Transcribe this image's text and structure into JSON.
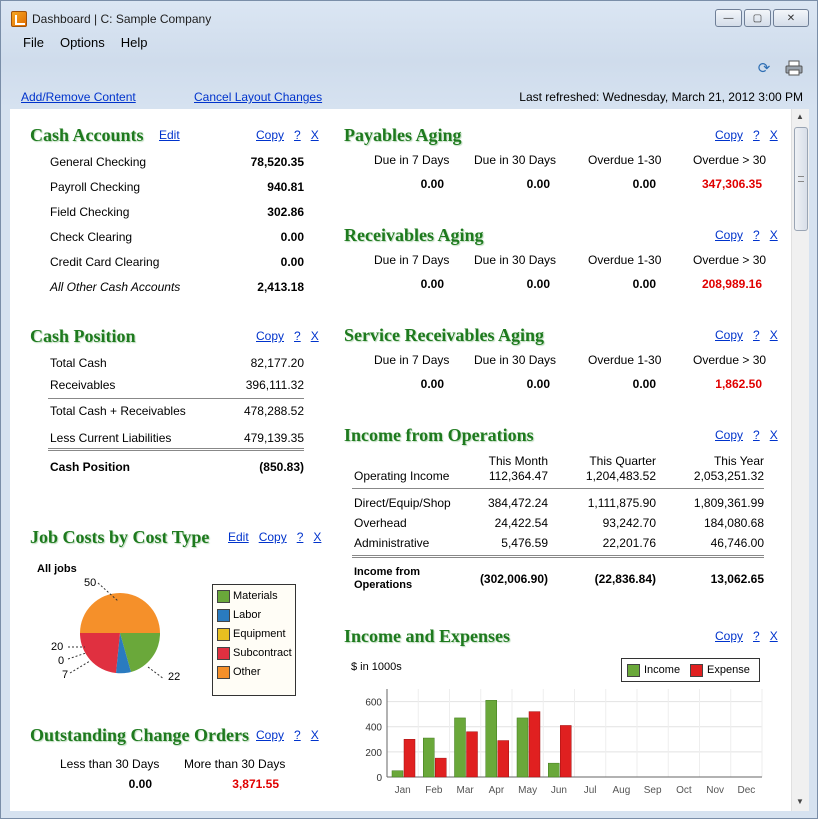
{
  "window": {
    "title": "Dashboard  |  C: Sample Company",
    "min": "—",
    "max": "▢",
    "close": "✕"
  },
  "menu": {
    "file": "File",
    "options": "Options",
    "help": "Help"
  },
  "toolbar": {
    "add_remove": "Add/Remove Content",
    "cancel_layout": "Cancel Layout Changes",
    "last_refreshed": "Last refreshed:  Wednesday, March 21, 2012  3:00 PM"
  },
  "common": {
    "edit": "Edit",
    "copy": "Copy",
    "help": "?",
    "close": "X"
  },
  "cash_accounts": {
    "title": "Cash Accounts",
    "rows": [
      {
        "label": "General Checking",
        "value": "78,520.35"
      },
      {
        "label": "Payroll Checking",
        "value": "940.81"
      },
      {
        "label": "Field Checking",
        "value": "302.86"
      },
      {
        "label": "Check Clearing",
        "value": "0.00"
      },
      {
        "label": "Credit Card Clearing",
        "value": "0.00"
      },
      {
        "label": "All Other Cash Accounts",
        "value": "2,413.18"
      }
    ]
  },
  "cash_position": {
    "title": "Cash Position",
    "rows": [
      {
        "label": "Total Cash",
        "value": "82,177.20"
      },
      {
        "label": "Receivables",
        "value": "396,111.32"
      },
      {
        "label": "Total Cash + Receivables",
        "value": "478,288.52"
      },
      {
        "label": "Less Current Liabilities",
        "value": "479,139.35"
      },
      {
        "label": "Cash Position",
        "value": "(850.83)"
      }
    ]
  },
  "job_costs": {
    "title": "Job Costs by Cost Type",
    "subtitle": "All jobs",
    "labels": [
      "50",
      "20",
      "0",
      "7",
      "22"
    ],
    "legend": [
      {
        "name": "Materials",
        "color": "#6aa83a"
      },
      {
        "name": "Labor",
        "color": "#2a7bc0"
      },
      {
        "name": "Equipment",
        "color": "#e8c020"
      },
      {
        "name": "Subcontract",
        "color": "#e03040"
      },
      {
        "name": "Other",
        "color": "#f5902a"
      }
    ]
  },
  "change_orders": {
    "title": "Outstanding Change Orders",
    "col1": "Less than 30 Days",
    "col2": "More than 30 Days",
    "val1": "0.00",
    "val2": "3,871.55"
  },
  "payables": {
    "title": "Payables Aging",
    "headers": [
      "Due in 7 Days",
      "Due in 30 Days",
      "Overdue 1-30",
      "Overdue > 30"
    ],
    "values": [
      "0.00",
      "0.00",
      "0.00",
      "347,306.35"
    ]
  },
  "receivables": {
    "title": "Receivables Aging",
    "headers": [
      "Due in 7 Days",
      "Due in 30 Days",
      "Overdue 1-30",
      "Overdue > 30"
    ],
    "values": [
      "0.00",
      "0.00",
      "0.00",
      "208,989.16"
    ]
  },
  "service_receivables": {
    "title": "Service Receivables Aging",
    "headers": [
      "Due in 7 Days",
      "Due in 30 Days",
      "Overdue 1-30",
      "Overdue > 30"
    ],
    "values": [
      "0.00",
      "0.00",
      "0.00",
      "1,862.50"
    ]
  },
  "income_ops": {
    "title": "Income from Operations",
    "headers": [
      "This Month",
      "This Quarter",
      "This Year"
    ],
    "rows": [
      {
        "label": "Operating Income",
        "v": [
          "112,364.47",
          "1,204,483.52",
          "2,053,251.32"
        ]
      },
      {
        "label": "Direct/Equip/Shop",
        "v": [
          "384,472.24",
          "1,111,875.90",
          "1,809,361.99"
        ]
      },
      {
        "label": "Overhead",
        "v": [
          "24,422.54",
          "93,242.70",
          "184,080.68"
        ]
      },
      {
        "label": "Administrative",
        "v": [
          "5,476.59",
          "22,201.76",
          "46,746.00"
        ]
      }
    ],
    "total_label1": "Income from",
    "total_label2": "Operations",
    "total": [
      "(302,006.90)",
      "(22,836.84)",
      "13,062.65"
    ]
  },
  "income_expenses": {
    "title": "Income and Expenses",
    "unit": "$ in 1000s",
    "legend": [
      {
        "name": "Income",
        "color": "#6aa83a"
      },
      {
        "name": "Expense",
        "color": "#e02020"
      }
    ],
    "y_ticks": [
      "600",
      "400",
      "200",
      "0"
    ]
  },
  "chart_data": {
    "type": "bar",
    "ylabel": "$ in 1000s",
    "ylim": [
      0,
      700
    ],
    "categories": [
      "Jan",
      "Feb",
      "Mar",
      "Apr",
      "May",
      "Jun",
      "Jul",
      "Aug",
      "Sep",
      "Oct",
      "Nov",
      "Dec"
    ],
    "series": [
      {
        "name": "Income",
        "values": [
          50,
          310,
          470,
          610,
          470,
          110,
          null,
          null,
          null,
          null,
          null,
          null
        ]
      },
      {
        "name": "Expense",
        "values": [
          300,
          150,
          360,
          290,
          520,
          410,
          null,
          null,
          null,
          null,
          null,
          null
        ]
      }
    ]
  }
}
